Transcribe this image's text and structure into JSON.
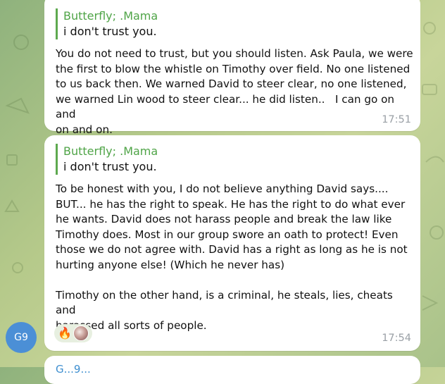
{
  "messages": [
    {
      "reply": {
        "name": "Butterfly; .Mama",
        "text": "i don't trust you."
      },
      "text": "You do not need to trust, but you should listen. Ask Paula, we were\nthe first to blow the whistle on Timothy over field. No one listened\nto us back then. We warned David to steer clear, no one listened,\nwe warned Lin wood to steer clear... he did listen..   I can go on and\non and on.",
      "time": "17:51"
    },
    {
      "reply": {
        "name": "Butterfly; .Mama",
        "text": "i don't trust you."
      },
      "text": "To be honest with you, I do not believe anything David says....\nBUT... he has the right to speak. He has the right to do what ever\nhe wants. David does not harass people and break the law like\nTimothy does. Most in our group swore an oath to protect! Even\nthose we do not agree with. David has a right as long as he is not\nhurting anyone else! (Which he never has)\n\nTimothy on the other hand, is a criminal, he steals, lies, cheats and\nharassed all sorts of people.",
      "time": "17:54",
      "reactions": {
        "emoji": "🔥",
        "icon": "user-avatar-thumbnail"
      }
    }
  ],
  "sender_avatar": {
    "initials": "G9",
    "color": "#4b8fd6"
  },
  "partial_next_message": {
    "name": "G...9..."
  },
  "colors": {
    "reply_accent": "#5ea94f",
    "time": "#9aa0a6",
    "bubble": "#ffffff"
  }
}
